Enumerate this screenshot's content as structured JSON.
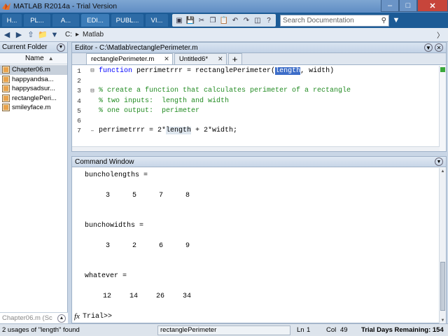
{
  "window": {
    "title": "MATLAB R2014a - Trial Version"
  },
  "ribbon": {
    "tabs": [
      "H...",
      "PL...",
      "A...",
      "EDI...",
      "PUBL...",
      "VI..."
    ],
    "search_placeholder": "Search Documentation"
  },
  "address": {
    "drive": "C:",
    "folder": "Matlab"
  },
  "current_folder": {
    "title": "Current Folder",
    "column_name": "Name",
    "files": [
      "Chapter06.m",
      "happyandsa...",
      "happysadsur...",
      "rectanglePeri...",
      "smileyface.m"
    ],
    "details_label": "Chapter06.m (Sc"
  },
  "editor": {
    "title": "Editor - C:\\Matlab\\rectanglePerimeter.m",
    "tabs": [
      "rectanglePerimeter.m",
      "Untitled6*"
    ],
    "plus_label": "+",
    "code": {
      "l1_kw": "function",
      "l1_a": " perrimetrrr = rectanglePerimeter(",
      "l1_hl": "length",
      "l1_b": ", width)",
      "l3": "% create a function that calculates perimeter of a rectangle",
      "l4": "% two inputs:  length and width",
      "l5": "% one output:  perimeter",
      "l7_a": "perrimetrrr = 2*",
      "l7_ul": "length",
      "l7_b": " + 2*width;"
    },
    "line_numbers": [
      "1",
      "2",
      "3",
      "4",
      "5",
      "6",
      "7"
    ]
  },
  "command_window": {
    "title": "Command Window",
    "vars": [
      {
        "name": "buncholengths =",
        "values": [
          "3",
          "5",
          "7",
          "8"
        ]
      },
      {
        "name": "bunchowidths =",
        "values": [
          "3",
          "2",
          "6",
          "9"
        ]
      },
      {
        "name": "whatever =",
        "values": [
          "12",
          "14",
          "26",
          "34"
        ]
      }
    ],
    "prompt": "Trial>>",
    "fx": "fx"
  },
  "status": {
    "message": "2 usages of \"length\" found",
    "function_name": "rectanglePerimeter",
    "ln_label": "Ln",
    "ln_value": "1",
    "col_label": "Col",
    "col_value": "49",
    "trial": "Trial Days Remaining: 154"
  }
}
